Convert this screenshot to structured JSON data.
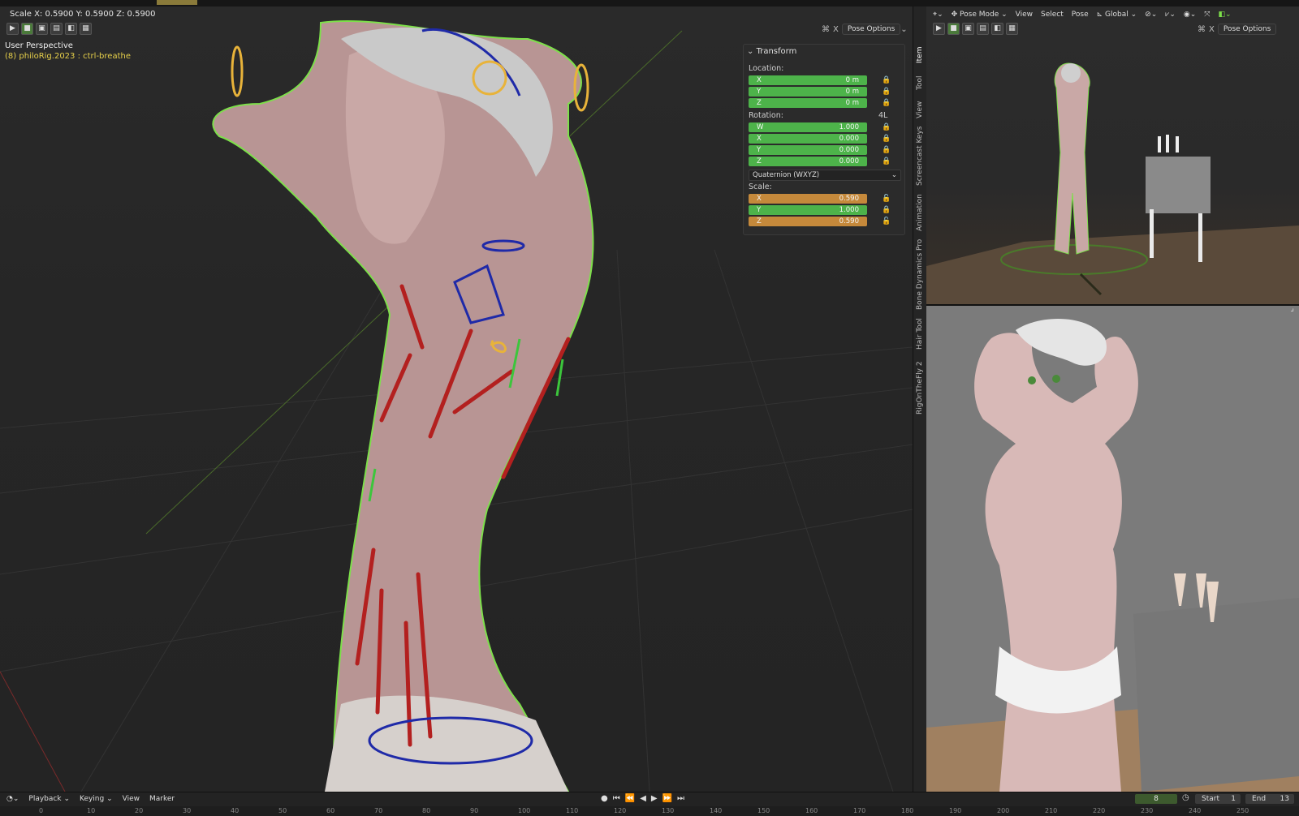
{
  "status_line": "Scale X: 0.5900   Y: 0.5900   Z: 0.5900",
  "viewport_label": "User Perspective",
  "object_label": "(8) philoRig.2023 : ctrl-breathe",
  "overlay": {
    "pose_options": "Pose Options"
  },
  "npanel": {
    "header": "Transform",
    "location_label": "Location:",
    "location": [
      {
        "axis": "X",
        "value": "0 m"
      },
      {
        "axis": "Y",
        "value": "0 m"
      },
      {
        "axis": "Z",
        "value": "0 m"
      }
    ],
    "rotation_label": "Rotation:",
    "rotation_mode_tag": "4L",
    "rotation": [
      {
        "axis": "W",
        "value": "1.000"
      },
      {
        "axis": "X",
        "value": "0.000"
      },
      {
        "axis": "Y",
        "value": "0.000"
      },
      {
        "axis": "Z",
        "value": "0.000"
      }
    ],
    "rotation_mode": "Quaternion (WXYZ)",
    "scale_label": "Scale:",
    "scale": [
      {
        "axis": "X",
        "value": "0.590"
      },
      {
        "axis": "Y",
        "value": "1.000"
      },
      {
        "axis": "Z",
        "value": "0.590"
      }
    ]
  },
  "side_tabs": [
    "Item",
    "Tool",
    "View",
    "Screencast Keys",
    "Animation",
    "Bone Dynamics Pro",
    "Hair Tool",
    "RigOnTheFly 2"
  ],
  "right_header": {
    "mode": "Pose Mode",
    "menus": [
      "View",
      "Select",
      "Pose"
    ],
    "orientation": "Global",
    "pose_options": "Pose Options"
  },
  "timeline": {
    "menus": [
      "Playback",
      "Keying",
      "View",
      "Marker"
    ],
    "current_frame": "8",
    "start_label": "Start",
    "start_value": "1",
    "end_label": "End",
    "end_value": "13",
    "ruler": [
      "0",
      "10",
      "20",
      "30",
      "40",
      "50",
      "60",
      "70",
      "80",
      "90",
      "100",
      "110",
      "120",
      "130",
      "140",
      "150",
      "160",
      "170",
      "180",
      "190",
      "200",
      "210",
      "220",
      "230",
      "240",
      "250"
    ]
  },
  "colors": {
    "field_green": "#4db34a",
    "field_orange": "#c5893b",
    "object_label": "#e7d04a",
    "bone_red": "#b3201f",
    "bone_blue": "#1f2aa8",
    "outline_green": "#7de04a"
  },
  "icons": {
    "lock": "lock-icon",
    "unlock": "unlock-icon",
    "select": "select-cursor-icon",
    "transport": [
      "jump-start-icon",
      "prev-key-icon",
      "play-reverse-icon",
      "play-icon",
      "next-key-icon",
      "jump-end-icon"
    ]
  }
}
